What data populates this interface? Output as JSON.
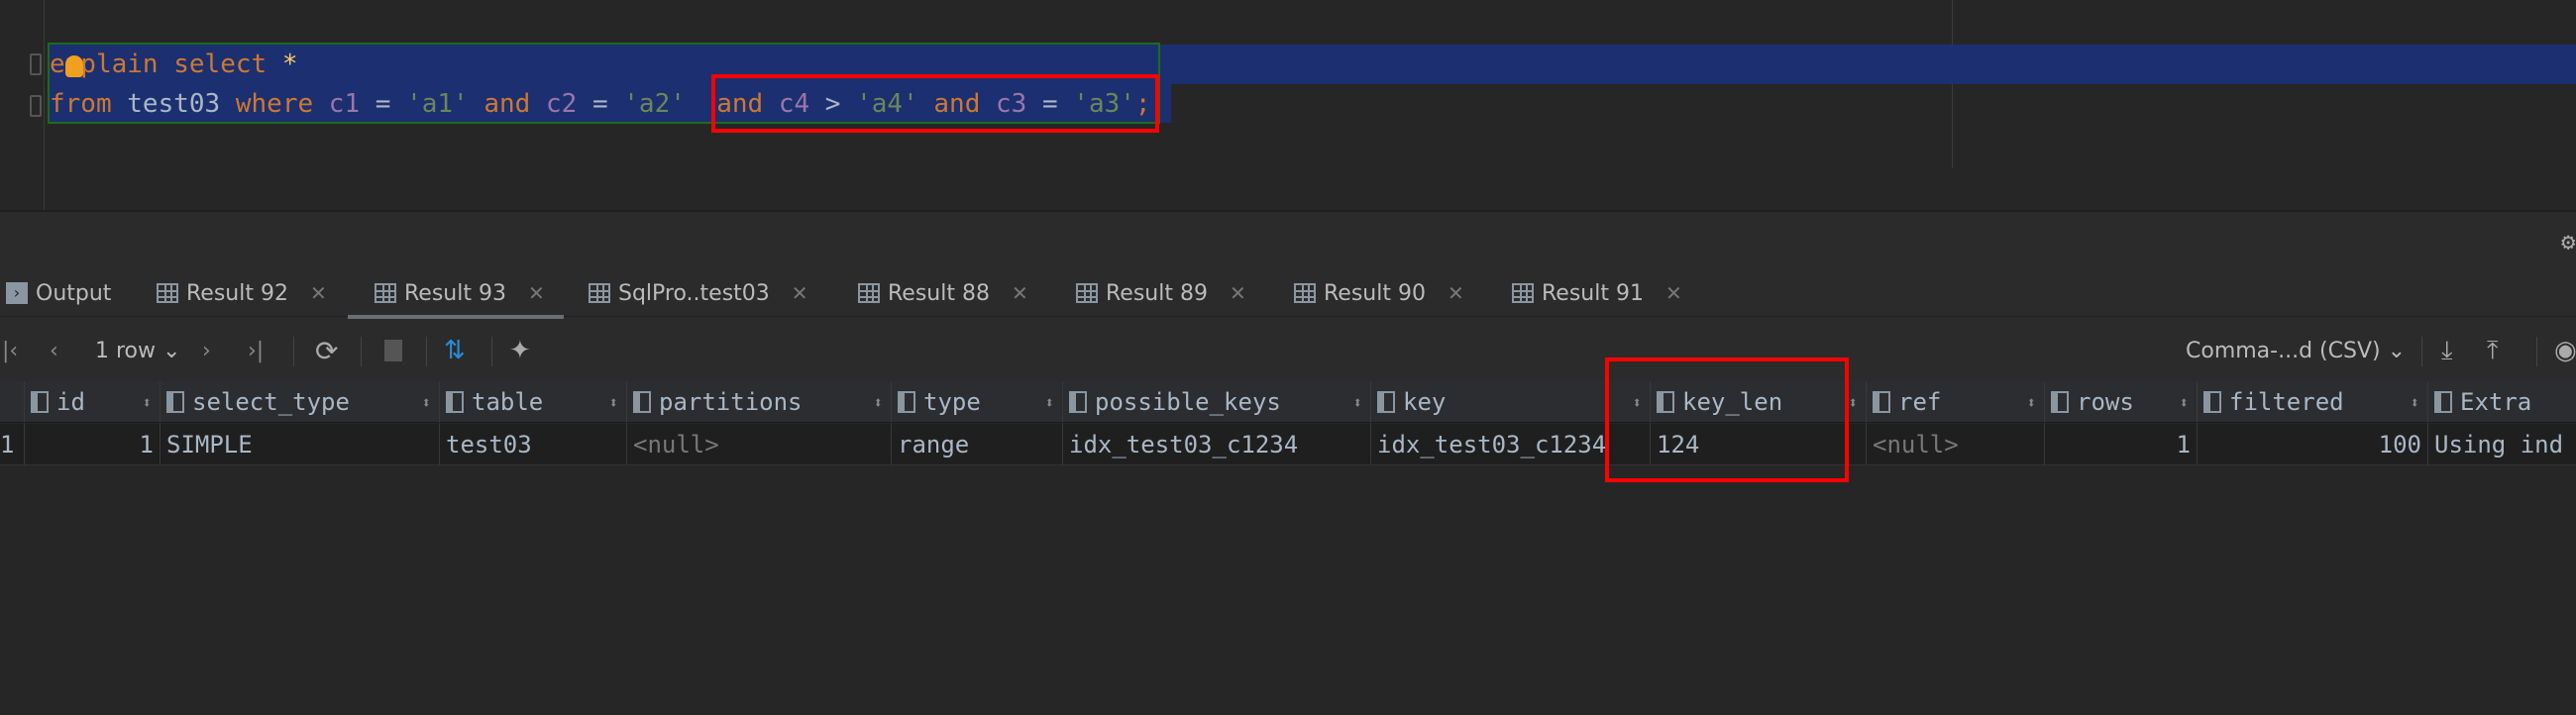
{
  "editor": {
    "line1": [
      "explain",
      "select",
      "*"
    ],
    "line2": {
      "from": "from",
      "table": "test03",
      "where": "where",
      "c1": "c1",
      "eq": "=",
      "a1": "'a1'",
      "and": "and",
      "c2": "c2",
      "a2": "'a2'",
      "c4": "c4",
      "gt": ">",
      "a4": "'a4'",
      "c3": "c3",
      "a3": "'a3'",
      "semi": ";"
    }
  },
  "tabs": [
    {
      "label": "Output"
    },
    {
      "label": "Result 92"
    },
    {
      "label": "Result 93",
      "active": true
    },
    {
      "label": "SqlPro..test03"
    },
    {
      "label": "Result 88"
    },
    {
      "label": "Result 89"
    },
    {
      "label": "Result 90"
    },
    {
      "label": "Result 91"
    }
  ],
  "toolbar": {
    "rows": "1 row",
    "export_format": "Comma-...d (CSV)"
  },
  "table": {
    "columns": [
      "id",
      "select_type",
      "table",
      "partitions",
      "type",
      "possible_keys",
      "key",
      "key_len",
      "ref",
      "rows",
      "filtered",
      "Extra"
    ],
    "row": {
      "rownum": "1",
      "id": "1",
      "select_type": "SIMPLE",
      "table": "test03",
      "partitions": "<null>",
      "type": "range",
      "possible_keys": "idx_test03_c1234",
      "key": "idx_test03_c1234",
      "key_len": "124",
      "ref": "<null>",
      "rows": "1",
      "filtered": "100",
      "Extra": "Using ind"
    }
  },
  "colors": {
    "keyword": "#cc7832",
    "column": "#9876aa",
    "string": "#6a8759",
    "highlight": "#ff0000",
    "selection": "#1c2f70"
  }
}
